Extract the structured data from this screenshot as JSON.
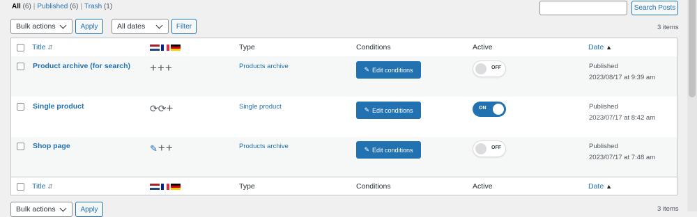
{
  "filters": {
    "all_label": "All",
    "all_count": "(6)",
    "published_label": "Published",
    "published_count": "(6)",
    "trash_label": "Trash",
    "trash_count": "(1)"
  },
  "search": {
    "placeholder": "",
    "button_label": "Search Posts"
  },
  "toolbar_top": {
    "bulk_actions": "Bulk actions",
    "apply": "Apply",
    "dates": "All dates",
    "filter": "Filter",
    "items_count": "3 items"
  },
  "columns": {
    "title": "Title",
    "type": "Type",
    "conditions": "Conditions",
    "active": "Active",
    "date": "Date"
  },
  "rows": [
    {
      "title": "Product archive (for search)",
      "type": "Products archive",
      "edit_label": "Edit conditions",
      "active": false,
      "toggle_label": "OFF",
      "status": "Published",
      "date": "2023/08/17 at 9:39 am",
      "lang_icons": [
        "plus-icon",
        "plus-icon",
        "plus-icon"
      ]
    },
    {
      "title": "Single product",
      "type": "Single product",
      "edit_label": "Edit conditions",
      "active": true,
      "toggle_label": "ON",
      "status": "Published",
      "date": "2023/07/17 at 8:42 am",
      "lang_icons": [
        "sync-icon",
        "sync-icon",
        "plus-icon"
      ]
    },
    {
      "title": "Shop page",
      "type": "Products archive",
      "edit_label": "Edit conditions",
      "active": false,
      "toggle_label": "OFF",
      "status": "Published",
      "date": "2023/07/17 at 7:48 am",
      "lang_icons": [
        "pencil-icon",
        "plus-icon",
        "plus-icon"
      ]
    }
  ],
  "toolbar_bottom": {
    "bulk_actions": "Bulk actions",
    "apply": "Apply",
    "items_count": "3 items"
  },
  "colors": {
    "accent": "#2271b1",
    "background": "#f0f0f1",
    "row_alt": "#f6f7f7"
  }
}
